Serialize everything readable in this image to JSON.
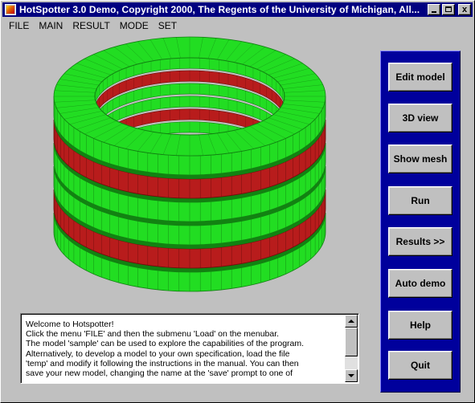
{
  "window": {
    "title": "HotSpotter 3.0 Demo,  Copyright 2000,  The Regents of the University of Michigan,  All...",
    "close_glyph": "x"
  },
  "menu": [
    "FILE",
    "MAIN",
    "RESULT",
    "MODE",
    "SET"
  ],
  "buttons": [
    "Edit model",
    "3D view",
    "Show mesh",
    "Run",
    "Results >>",
    "Auto demo",
    "Help",
    "Quit"
  ],
  "console": {
    "lines": [
      "Welcome to Hotspotter!",
      "Click the menu 'FILE' and then the submenu 'Load' on the menubar.",
      "The model 'sample' can be used to explore the capabilities of the program.",
      "Alternatively, to develop a model to your own specification, load the file",
      "'temp' and modify it following the instructions in the manual. You can then",
      "save your new model, changing the name at the 'save' prompt to one of"
    ]
  },
  "model_view": {
    "object": "stacked-ring-cylinder",
    "layers_top_to_bottom": [
      "green",
      "red",
      "green",
      "green",
      "red",
      "green"
    ],
    "colors": {
      "green": "#22dd22",
      "green_dark": "#128212",
      "red": "#b81c1c",
      "red_dark": "#6e0c0c",
      "panel_blue": "#00009c",
      "titlebar": "#000080"
    }
  }
}
